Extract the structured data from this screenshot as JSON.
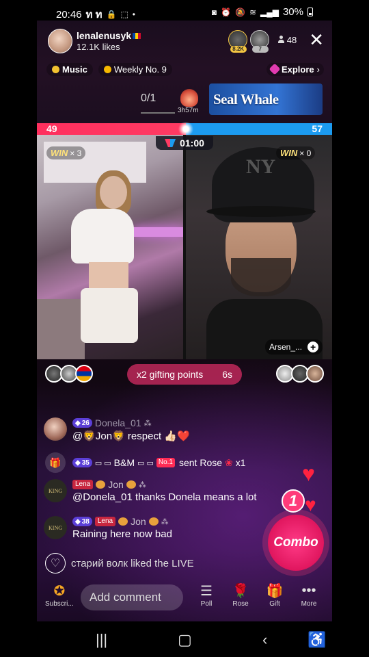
{
  "status_bar": {
    "time": "20:46",
    "carrier_icons": "ท ท",
    "battery_pct": "30%"
  },
  "host": {
    "name": "lenalenusyk",
    "likes": "12.1K likes"
  },
  "top_right": {
    "badge1": "8.2K",
    "badge2": "7",
    "viewer_count": "48"
  },
  "info_row": {
    "music": "Music",
    "weekly": "Weekly No. 9",
    "explore": "Explore"
  },
  "ranking": {
    "rank": "0/1",
    "timer": "3h57m",
    "banner": "Seal Whale"
  },
  "battle": {
    "left_score": "49",
    "right_score": "57",
    "timer": "01:00",
    "left_win": "WIN",
    "left_mult": "× 3",
    "right_win": "WIN",
    "right_mult": "× 0",
    "left_progress": 0.505,
    "opponent_name": "Arsen_..."
  },
  "gifting": {
    "label": "x2 gifting points",
    "time": "6s"
  },
  "comments": [
    {
      "level": "26",
      "user": "Donela_01",
      "text": "@🦁Jon🦁 respect 👍🏻❤️"
    },
    {
      "level": "35",
      "user": "B&M",
      "rank_badge": "No.1",
      "action": "sent Rose",
      "count": "x1"
    },
    {
      "badge": "Lena",
      "user": "Jon",
      "text": "@Donela_01 thanks Donela means a lot"
    },
    {
      "level": "38",
      "badge": "Lena",
      "user": "Jon",
      "text": "Raining here now bad"
    }
  ],
  "liked": {
    "text": "старий волк liked the LIVE"
  },
  "combo": {
    "label": "Combo",
    "count": "1"
  },
  "toolbar": {
    "subscribe": "Subscri...",
    "add_comment": "Add comment",
    "poll": "Poll",
    "rose": "Rose",
    "gift": "Gift",
    "more": "More"
  },
  "colors": {
    "red_team": "#ff2f5e",
    "blue_team": "#1c9bf0",
    "combo": "#e0165e"
  }
}
